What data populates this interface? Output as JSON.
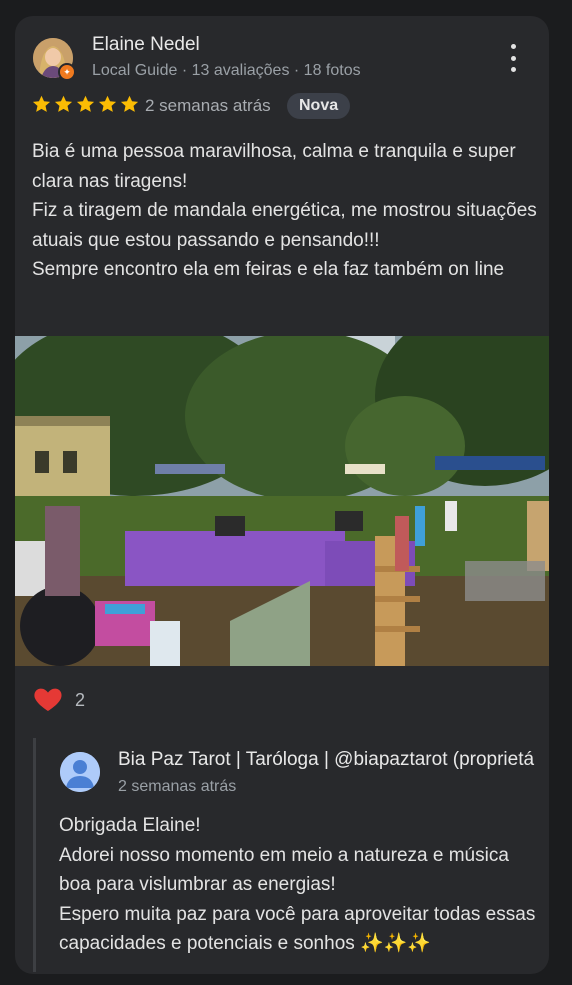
{
  "review": {
    "reviewer_name": "Elaine Nedel",
    "reviewer_meta": "Local Guide · 13 avaliações · 18 fotos",
    "rating": 5,
    "rating_max": 5,
    "date": "2 semanas atrás",
    "badge": "Nova",
    "text": "Bia é uma pessoa maravilhosa, calma e tranquila e super clara nas tiragens!\nFiz a tiragem de mandala energética, me mostrou situações atuais que estou passando e pensando!!!\nSempre encontro ela em feiras e ela faz também on line",
    "likes": "2"
  },
  "reply": {
    "owner_name": "Bia Paz Tarot | Taróloga | @biapaztarot (proprietá",
    "date": "2 semanas atrás",
    "text": "Obrigada Elaine!\nAdorei nosso momento em meio a natureza e música boa para vislumbrar as energias!\nEspero muita paz para você para aproveitar todas essas capacidades e potenciais e sonhos ✨✨✨"
  },
  "colors": {
    "card_bg": "#28292c",
    "page_bg": "#1b1c1e",
    "star": "#fbbc04",
    "heart": "#e53935",
    "guide_badge": "#f07a1f",
    "new_badge_bg": "#3c4049"
  },
  "icons": {
    "menu": "more-vert-icon",
    "rating": "star-icon",
    "reaction": "heart-icon",
    "guide": "local-guide-badge-icon",
    "owner": "person-avatar-icon"
  }
}
